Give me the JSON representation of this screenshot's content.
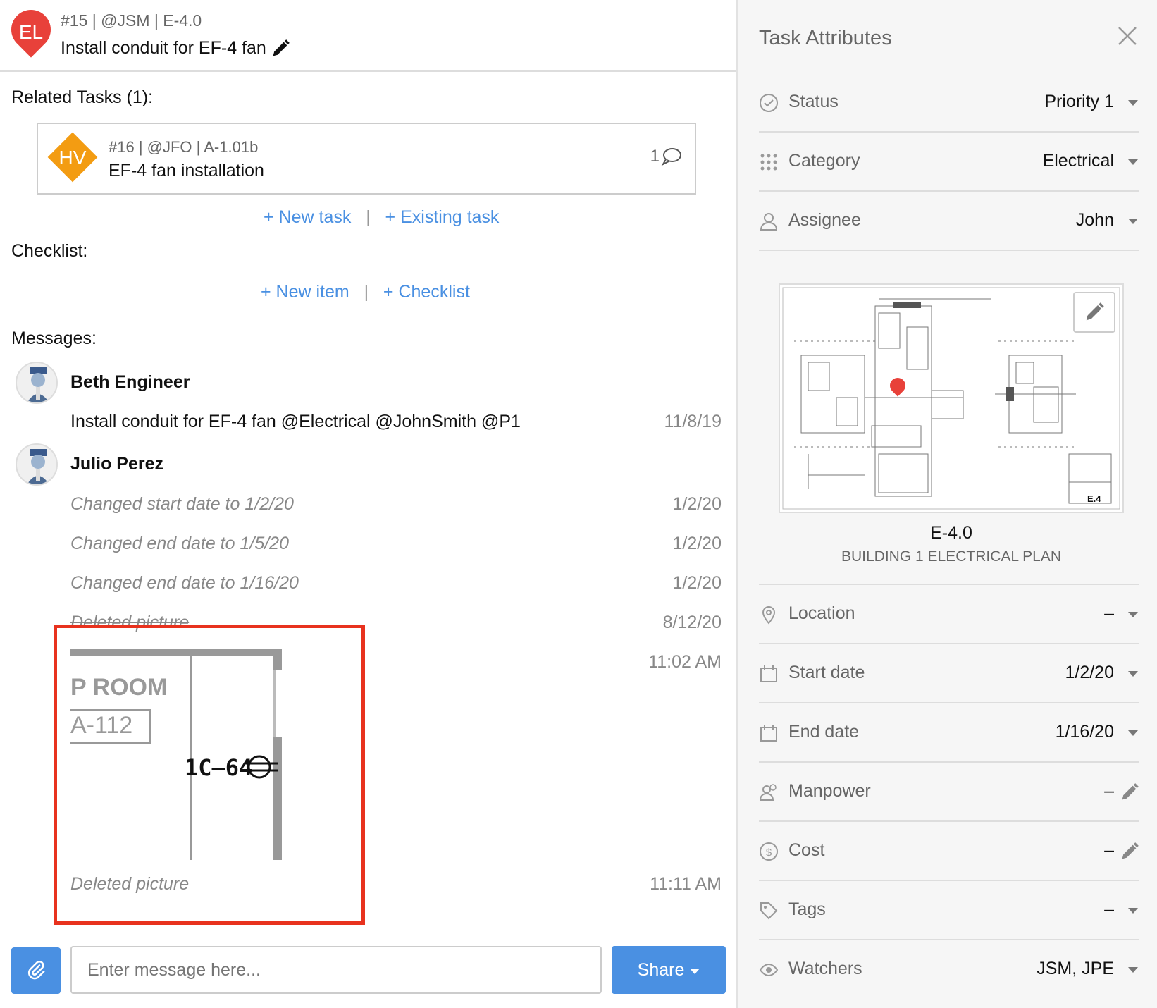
{
  "header": {
    "pin_initials": "EL",
    "meta": "#15 | @JSM | E-4.0",
    "title": "Install conduit for EF-4 fan",
    "pin_color": "#e8413a"
  },
  "related": {
    "heading": "Related Tasks (1):",
    "task": {
      "initials": "HV",
      "meta": "#16 | @JFO | A-1.01b",
      "title": "EF-4 fan installation",
      "comment_count": "1",
      "color": "#f39c12"
    },
    "new_task": "+ New task",
    "existing_task": "+ Existing task"
  },
  "checklist": {
    "heading": "Checklist:",
    "new_item": "+ New item",
    "checklist_link": "+ Checklist"
  },
  "messages": {
    "heading": "Messages:",
    "items": [
      {
        "author": "Beth Engineer",
        "text": "Install conduit for EF-4 fan @Electrical @JohnSmith  @P1",
        "date": "11/8/19"
      },
      {
        "author": "Julio Perez",
        "history": [
          {
            "text": "Changed start date to 1/2/20",
            "date": "1/2/20"
          },
          {
            "text": "Changed end date to 1/5/20",
            "date": "1/2/20"
          },
          {
            "text": "Changed end date to 1/16/20",
            "date": "1/2/20"
          },
          {
            "text": "Deleted picture",
            "date": "8/12/20"
          },
          {
            "text": "",
            "date": "11:02 AM"
          },
          {
            "text": "Deleted picture",
            "date": "11:11 AM"
          }
        ]
      }
    ]
  },
  "snippet": {
    "room": "P ROOM",
    "room_number": "A-112",
    "tag": "1C–64"
  },
  "composer": {
    "placeholder": "Enter message here...",
    "share_label": "Share",
    "accent": "#4a90e2"
  },
  "attributes": {
    "title": "Task Attributes",
    "status": {
      "label": "Status",
      "value": "Priority 1"
    },
    "category": {
      "label": "Category",
      "value": "Electrical"
    },
    "assignee": {
      "label": "Assignee",
      "value": "John"
    },
    "sheet": {
      "number": "E-4.0",
      "name": "BUILDING 1 ELECTRICAL PLAN",
      "stamp": "E.4"
    },
    "location": {
      "label": "Location",
      "value": "–"
    },
    "start_date": {
      "label": "Start date",
      "value": "1/2/20"
    },
    "end_date": {
      "label": "End date",
      "value": "1/16/20"
    },
    "manpower": {
      "label": "Manpower",
      "value": "–"
    },
    "cost": {
      "label": "Cost",
      "value": "–"
    },
    "tags": {
      "label": "Tags",
      "value": "–"
    },
    "watchers": {
      "label": "Watchers",
      "value": "JSM, JPE"
    }
  },
  "highlight_color": "#e8321e"
}
